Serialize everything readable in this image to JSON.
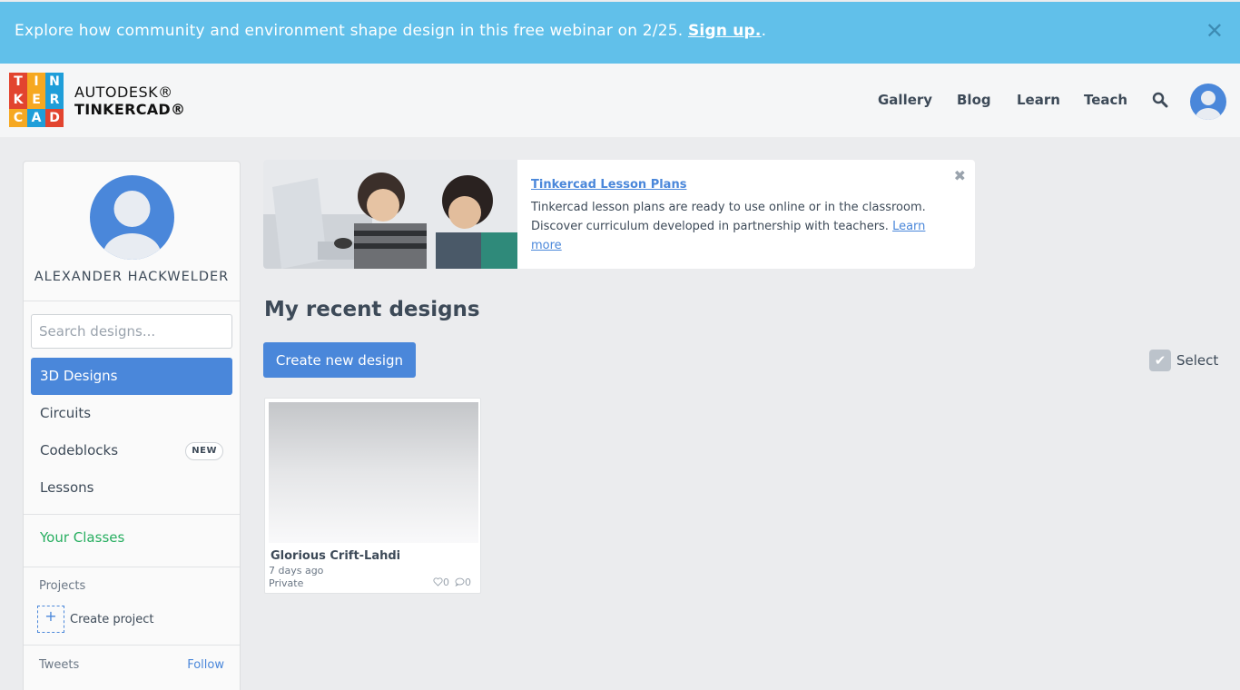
{
  "banner": {
    "text": "Explore how community and environment shape design in this free webinar on 2/25. ",
    "link": "Sign up.",
    "trailing": ".",
    "close_icon": "close-icon"
  },
  "header": {
    "logo": {
      "letters": [
        "T",
        "I",
        "N",
        "K",
        "E",
        "R",
        "C",
        "A",
        "D"
      ],
      "colors": [
        "#e2442f",
        "#f6a821",
        "#1f9ed9",
        "#e2442f",
        "#f6a821",
        "#1f9ed9",
        "#f6a821",
        "#1f9ed9",
        "#e2442f"
      ],
      "line1": "AUTODESK®",
      "line2": "TINKERCAD®"
    },
    "nav": [
      "Gallery",
      "Blog",
      "Learn",
      "Teach"
    ],
    "search_icon": "search-icon",
    "avatar_icon": "user-avatar-icon"
  },
  "sidebar": {
    "username": "ALEXANDER HACKWELDER",
    "search_placeholder": "Search designs...",
    "items": [
      {
        "label": "3D Designs",
        "active": true
      },
      {
        "label": "Circuits",
        "active": false
      },
      {
        "label": "Codeblocks",
        "active": false,
        "badge": "NEW"
      },
      {
        "label": "Lessons",
        "active": false
      }
    ],
    "classes_label": "Your Classes",
    "projects_label": "Projects",
    "create_project_label": "Create project",
    "tweets_label": "Tweets",
    "follow_label": "Follow"
  },
  "lesson": {
    "title": "Tinkercad Lesson Plans",
    "body": "Tinkercad lesson plans are ready to use online or in the classroom. Discover curriculum developed in partnership with teachers. ",
    "link": "Learn more"
  },
  "main": {
    "title": "My recent designs",
    "create_button": "Create new design",
    "select_label": "Select"
  },
  "designs": [
    {
      "name": "Glorious Crift-Lahdi",
      "date": "7 days ago",
      "privacy": "Private",
      "likes": "0",
      "comments": "0"
    }
  ],
  "colors": {
    "accent": "#4a87da",
    "banner": "#61c0ea",
    "classes": "#27ae60"
  }
}
